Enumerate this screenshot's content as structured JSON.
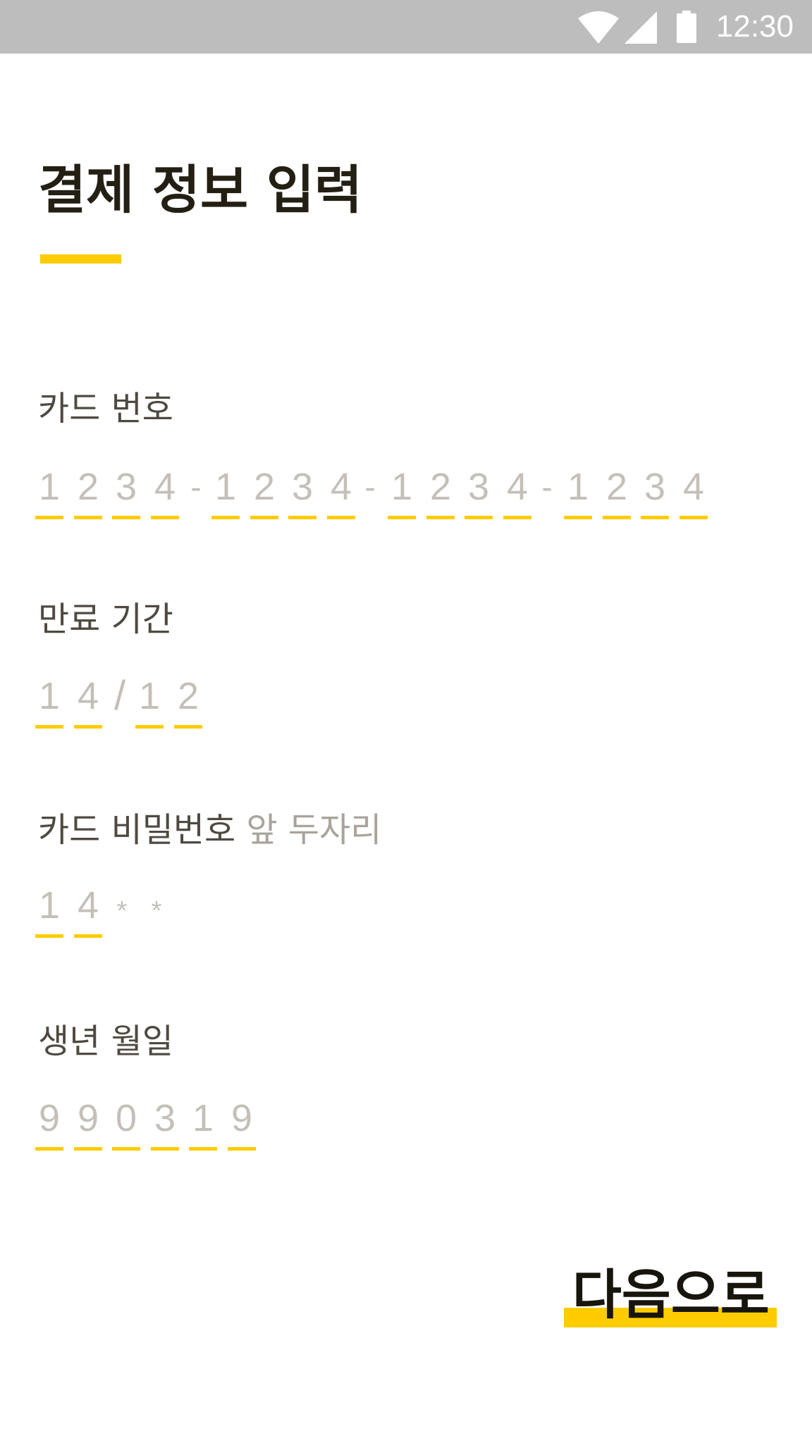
{
  "status_bar": {
    "time": "12:30",
    "icons": [
      "wifi-icon",
      "signal-icon",
      "battery-icon"
    ]
  },
  "colors": {
    "accent": "#ffcc00",
    "title": "#231f13",
    "label": "#4f4a40",
    "placeholder": "#c4c0b8"
  },
  "page": {
    "title": "결제 정보 입력"
  },
  "card_number": {
    "label": "카드 번호",
    "groups": [
      [
        "1",
        "2",
        "3",
        "4"
      ],
      [
        "1",
        "2",
        "3",
        "4"
      ],
      [
        "1",
        "2",
        "3",
        "4"
      ],
      [
        "1",
        "2",
        "3",
        "4"
      ]
    ],
    "separator": "-"
  },
  "expiry": {
    "label": "만료 기간",
    "month": [
      "1",
      "4"
    ],
    "year": [
      "1",
      "2"
    ],
    "separator": "/"
  },
  "card_password": {
    "label": "카드 비밀번호",
    "label_hint": "앞 두자리",
    "digits": [
      "1",
      "4"
    ],
    "masked": [
      "*",
      "*"
    ]
  },
  "birthdate": {
    "label": "생년 월일",
    "digits": [
      "9",
      "9",
      "0",
      "3",
      "1",
      "9"
    ]
  },
  "next_button": {
    "label": "다음으로"
  }
}
